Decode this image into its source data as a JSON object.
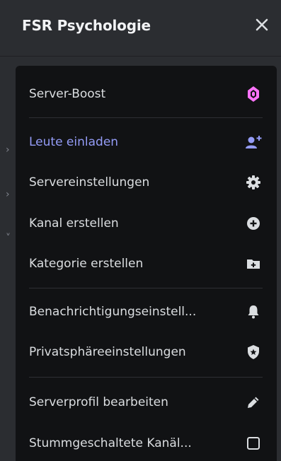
{
  "header": {
    "server_name": "FSR Psychologie",
    "close_icon": "close-icon"
  },
  "menu": {
    "items": [
      {
        "label": "Server-Boost",
        "icon": "boost-gem-icon"
      },
      {
        "label": "Leute einladen",
        "icon": "add-person-icon"
      },
      {
        "label": "Servereinstellungen",
        "icon": "gear-icon"
      },
      {
        "label": "Kanal erstellen",
        "icon": "plus-circle-icon"
      },
      {
        "label": "Kategorie erstellen",
        "icon": "folder-plus-icon"
      },
      {
        "label": "Benachrichtigungseinstell...",
        "icon": "bell-icon"
      },
      {
        "label": "Privatsphäreeinstellungen",
        "icon": "shield-star-icon"
      },
      {
        "label": "Serverprofil bearbeiten",
        "icon": "pencil-icon"
      },
      {
        "label": "Stummgeschaltete Kanäl...",
        "icon": "checkbox-icon"
      }
    ]
  },
  "colors": {
    "accent": "#949cf7",
    "boost": "#ff73fa",
    "background": "#2b2d31",
    "menu_background": "#111214",
    "text": "#dbdee1"
  }
}
